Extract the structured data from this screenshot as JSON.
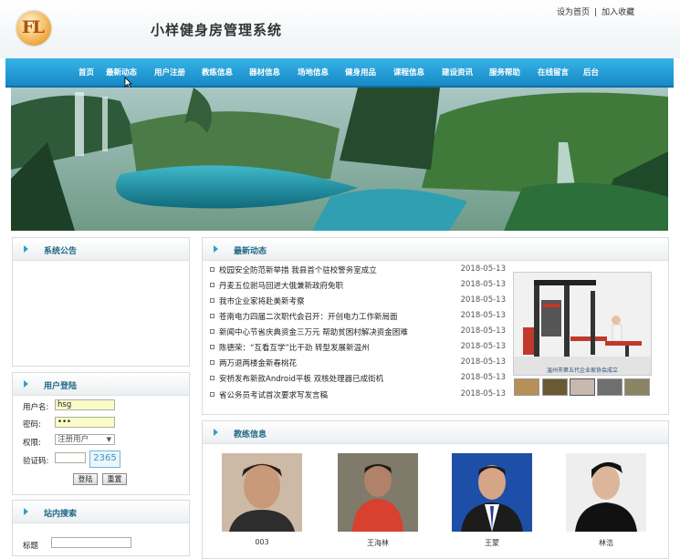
{
  "header": {
    "logo_text": "FL",
    "site_title": "小样健身房管理系统",
    "set_home": "设为首页",
    "separator": "|",
    "add_fav": "加入收藏"
  },
  "nav": {
    "items": [
      "首页",
      "最新动态",
      "用户注册",
      "教练信息",
      "器材信息",
      "场地信息",
      "健身用品",
      "课程信息",
      "建设资讯",
      "服务帮助",
      "在线留言",
      "后台"
    ]
  },
  "sidebar": {
    "notice_title": "系统公告",
    "login_title": "用户登陆",
    "username_label": "用户名:",
    "username_value": "hsg",
    "password_label": "密码:",
    "password_value": "•••",
    "role_label": "权限:",
    "role_value": "注册用户",
    "captcha_label": "验证码:",
    "captcha_value": "2365",
    "login_button": "登陆",
    "reset_button": "重置",
    "search_title": "站内搜索",
    "search_label": "标题"
  },
  "news": {
    "title": "最新动态",
    "items": [
      {
        "text": "校园安全防范新举措 我县首个驻校警务室成立",
        "date": "2018-05-13"
      },
      {
        "text": "丹麦五位驸马回进大俄兼新政府免职",
        "date": "2018-05-13"
      },
      {
        "text": "我市企业家将赴美新考察",
        "date": "2018-05-13"
      },
      {
        "text": "苍南电力四届二次职代会召开：开创电力工作新局面",
        "date": "2018-05-13"
      },
      {
        "text": "新闻中心节省庆典资金三万元 帮助贫困村解决资金困难",
        "date": "2018-05-13"
      },
      {
        "text": "陈德荣：“互看互学”比干劲 转型发展新温州",
        "date": "2018-05-13"
      },
      {
        "text": "两万退两楼金新春桃花",
        "date": "2018-05-13"
      },
      {
        "text": "安桥发布新款Android平板 双核处理器已成街机",
        "date": "2018-05-13"
      },
      {
        "text": "省公务员考试首次要求写发言稿",
        "date": "2018-05-13"
      }
    ],
    "image_caption": "温州市第五代企业家协会成立"
  },
  "coaches": {
    "title": "教练信息",
    "items": [
      {
        "name": "003"
      },
      {
        "name": "王海林"
      },
      {
        "name": "王蒙"
      },
      {
        "name": "林浩"
      }
    ]
  }
}
